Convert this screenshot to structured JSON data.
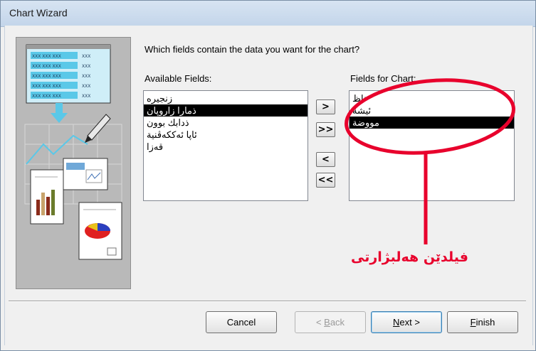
{
  "window": {
    "title": "Chart Wizard"
  },
  "prompt": {
    "question": "Which fields contain the data you want for the chart?"
  },
  "available": {
    "label": "Available Fields:",
    "items": [
      "زنجیره",
      "ذمارا زاروپان",
      "ذدابك بوون",
      "ئاپا ئەككەڤنية",
      "قەزا"
    ],
    "selected_index": 1
  },
  "selected": {
    "label": "Fields for Chart:",
    "items": [
      "ناظ",
      "ئيشة",
      "مووضة"
    ],
    "selected_index": 2
  },
  "move_buttons": {
    "add": ">",
    "add_all": ">>",
    "remove": "<",
    "remove_all": "<<"
  },
  "buttons": {
    "cancel": "Cancel",
    "back_prefix": "< ",
    "back_mnemonic": "B",
    "back_rest": "ack",
    "next_mnemonic": "N",
    "next_rest": "ext >",
    "finish_mnemonic": "F",
    "finish_rest": "inish"
  },
  "annotation": {
    "text": "فيلدێن هەلبژارتى",
    "color": "#e8002c"
  },
  "illustration": {
    "grid_text": "XXX XXX XXX XXX"
  }
}
